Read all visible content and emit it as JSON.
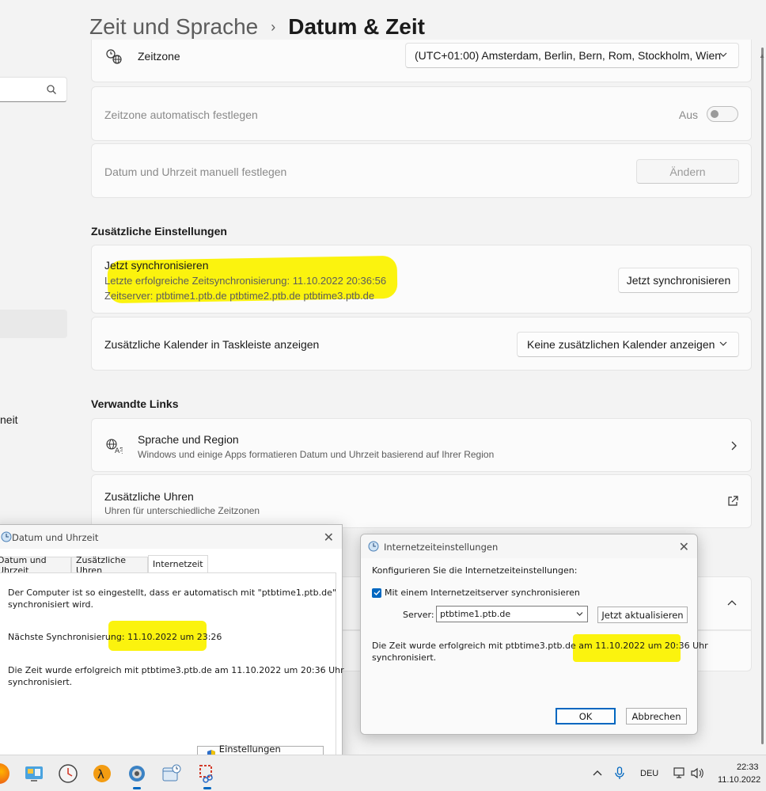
{
  "header": {
    "crumb": "Zeit und Sprache",
    "separator": "›",
    "current": "Datum & Zeit"
  },
  "sidebar": {
    "partial_item_text": "neit"
  },
  "timezone": {
    "label": "Zeitzone",
    "value": "(UTC+01:00) Amsterdam, Berlin, Bern, Rom, Stockholm, Wien"
  },
  "auto_timezone": {
    "label": "Zeitzone automatisch festlegen",
    "state_text": "Aus",
    "enabled": false
  },
  "manual_time": {
    "label": "Datum und Uhrzeit manuell festlegen",
    "button": "Ändern"
  },
  "additional_settings": {
    "title": "Zusätzliche Einstellungen",
    "sync": {
      "label": "Jetzt synchronisieren",
      "last_sync": "Letzte erfolgreiche Zeitsynchronisierung: 11.10.2022 20:36:56",
      "servers": "Zeitserver: ptbtime1.ptb.de ptbtime2.ptb.de ptbtime3.ptb.de",
      "button": "Jetzt synchronisieren"
    },
    "calendar": {
      "label": "Zusätzliche Kalender in Taskleiste anzeigen",
      "value": "Keine zusätzlichen Kalender anzeigen"
    }
  },
  "related_links": {
    "title": "Verwandte Links",
    "language": {
      "title": "Sprache und Region",
      "subtitle": "Windows und einige Apps formatieren Datum und Uhrzeit basierend auf Ihrer Region"
    },
    "clocks": {
      "title": "Zusätzliche Uhren",
      "subtitle": "Uhren für unterschiedliche Zeitzonen"
    }
  },
  "dialog_datetime": {
    "title": "Datum und Uhrzeit",
    "tabs": [
      "Datum und Uhrzeit",
      "Zusätzliche Uhren",
      "Internetzeit"
    ],
    "line1": "Der Computer ist so eingestellt, dass er automatisch mit \"ptbtime1.ptb.de\"",
    "line2": "synchronisiert wird.",
    "next_sync_prefix": "Nächste Synchronisierung: ",
    "next_sync_value": "11.10.2022 um 23:26",
    "success1": "Die Zeit wurde erfolgreich mit ptbtime3.ptb.de am 11.10.2022 um 20:36 Uhr",
    "success2": "synchronisiert.",
    "change_button": "Einstellungen ändern..."
  },
  "dialog_internet": {
    "title": "Internetzeiteinstellungen",
    "heading": "Konfigurieren Sie die Internetzeiteinstellungen:",
    "checkbox_label": "Mit einem Internetzeitserver synchronisieren",
    "checkbox_checked": true,
    "server_label": "Server:",
    "server_value": "ptbtime1.ptb.de",
    "update_button": "Jetzt aktualisieren",
    "status_prefix": "Die Zeit wurde erfolgreich mit ptbtime3.ptb.de am ",
    "status_highlight": "11.10.2022 um 20:36 Uhr",
    "status_line2": "synchronisiert.",
    "ok": "OK",
    "cancel": "Abbrechen"
  },
  "taskbar": {
    "language": "DEU",
    "time": "22:33",
    "date": "11.10.2022"
  },
  "colors": {
    "highlight": "#fbf30e",
    "accent": "#0067c0"
  }
}
